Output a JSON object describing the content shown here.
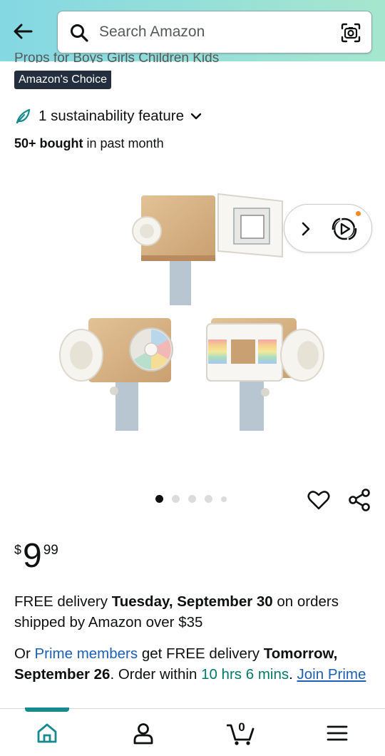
{
  "header": {
    "search_placeholder": "Search Amazon",
    "icons": [
      "back-arrow-icon",
      "search-icon",
      "camera-lens-icon"
    ]
  },
  "product": {
    "title_fragment": "Props for Boys Girls Children Kids",
    "badge": "Amazon's Choice",
    "sustainability": "1 sustainability feature",
    "bought_bold": "50+ bought",
    "bought_rest": " in past month",
    "image_count": 5,
    "active_image_index": 0
  },
  "price": {
    "symbol": "$",
    "whole": "9",
    "fraction": "99"
  },
  "delivery": {
    "prefix": "FREE delivery ",
    "date": "Tuesday, September 30",
    "suffix": " on orders shipped by Amazon over $35"
  },
  "prime": {
    "prefix": "Or ",
    "members_link": "Prime members",
    "middle": " get FREE delivery ",
    "date": "Tomorrow, September 26",
    "order_within": ". Order within ",
    "countdown": "10 hrs 6 mins",
    "period": ". ",
    "join_link": "Join Prime"
  },
  "nav": {
    "items": [
      "home-icon",
      "account-icon",
      "cart-icon",
      "menu-icon"
    ],
    "cart_count": "0"
  },
  "colors": {
    "header_gradient_start": "#84d8e3",
    "header_gradient_end": "#a6e6ce",
    "badge_bg": "#232f3e",
    "link": "#1c60b4",
    "teal": "#00796b",
    "nav_active": "#168a8f"
  }
}
